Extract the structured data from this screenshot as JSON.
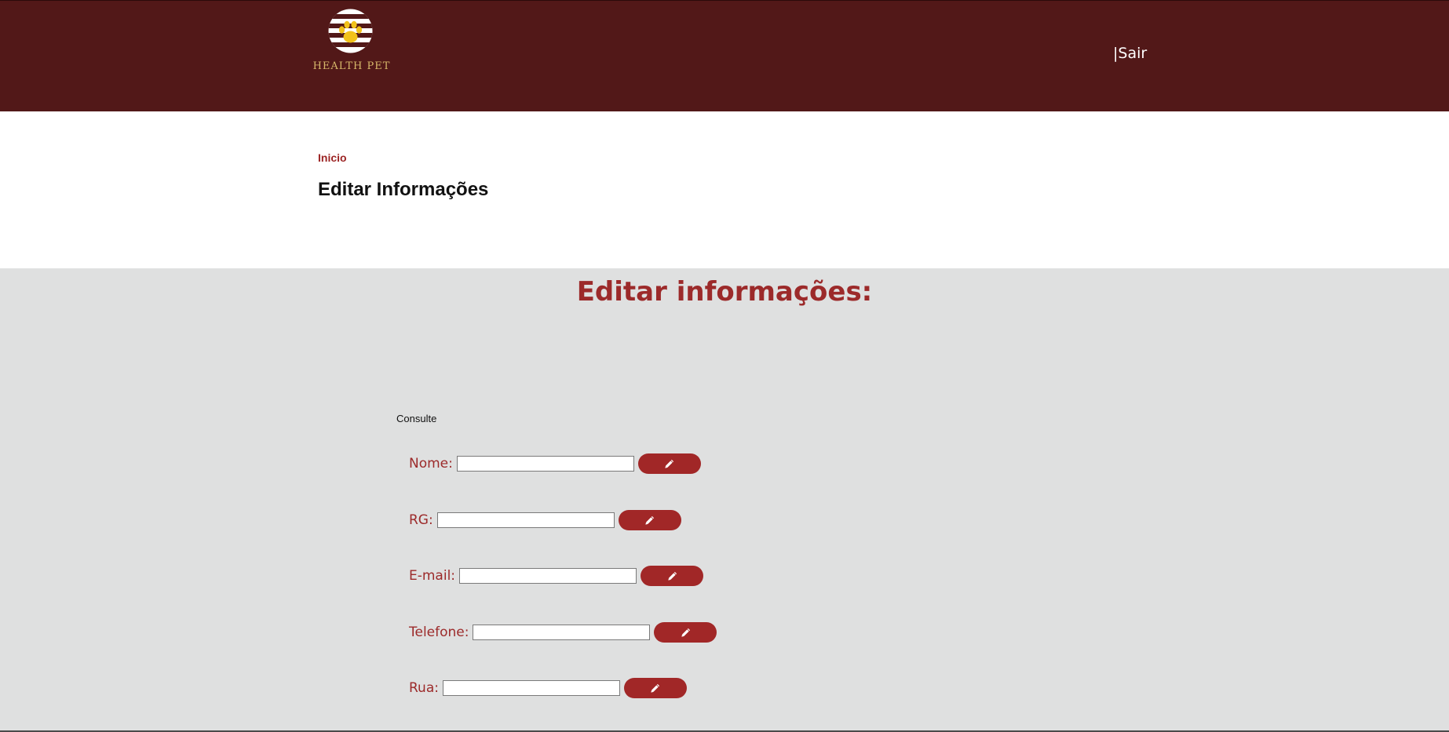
{
  "brand": {
    "name": "HEALTH PET",
    "colors": {
      "header": "#521818",
      "accent": "#a12727",
      "logo_gold": "#d7b86a"
    }
  },
  "header": {
    "logout_label": "|Sair"
  },
  "breadcrumb": {
    "home": "Inicio"
  },
  "page": {
    "title": "Editar Informações"
  },
  "form": {
    "heading": "Editar informações:",
    "tab_label": "Consulte",
    "edit_icon": "pencil-icon",
    "fields": [
      {
        "label": "Nome:",
        "value": ""
      },
      {
        "label": "RG:",
        "value": ""
      },
      {
        "label": "E-mail:",
        "value": ""
      },
      {
        "label": "Telefone:",
        "value": ""
      },
      {
        "label": "Rua:",
        "value": ""
      }
    ]
  }
}
